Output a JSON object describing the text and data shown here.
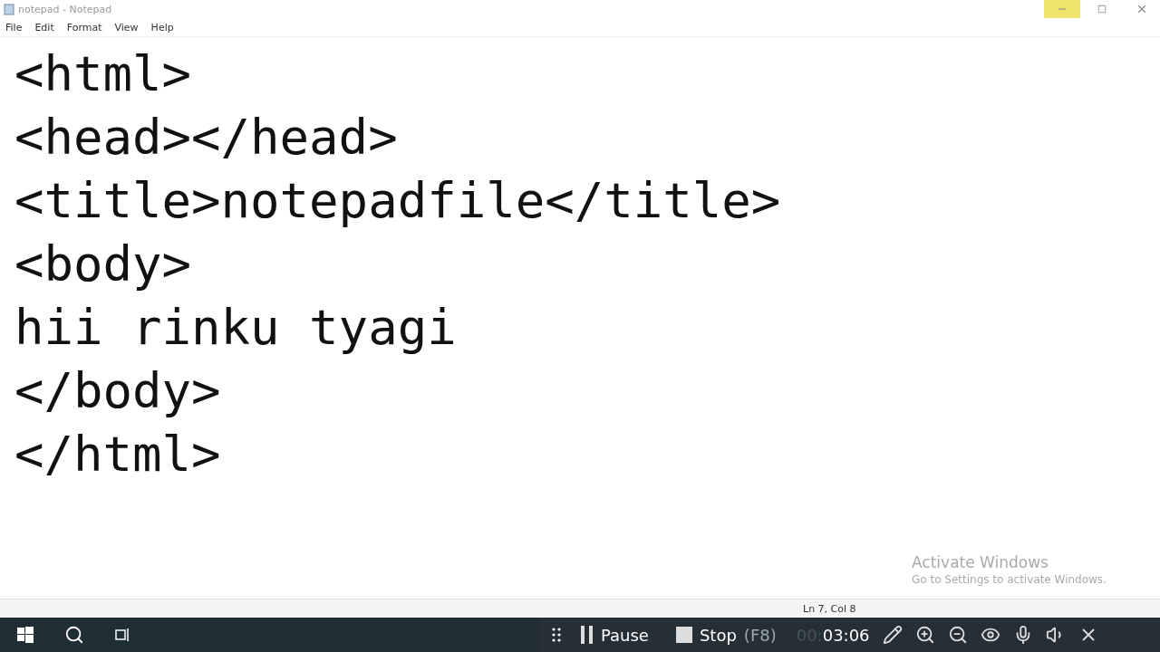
{
  "window": {
    "title": "notepad - Notepad"
  },
  "menu": [
    "File",
    "Edit",
    "Format",
    "View",
    "Help"
  ],
  "editor": {
    "lines": [
      "<html>",
      "<head></head>",
      "<title>notepadfile</title>",
      "<body>",
      "hii rinku tyagi",
      "</body>",
      "</html>"
    ]
  },
  "activation_notice": {
    "title": "Activate Windows",
    "subtitle": "Go to Settings to activate Windows."
  },
  "status_bar": {
    "position": "Ln 7, Col 8"
  },
  "recorder_bar": {
    "pause": "Pause",
    "stop": "Stop",
    "stop_key": "(F8)",
    "time_dim": "00:",
    "time": "03:06"
  }
}
